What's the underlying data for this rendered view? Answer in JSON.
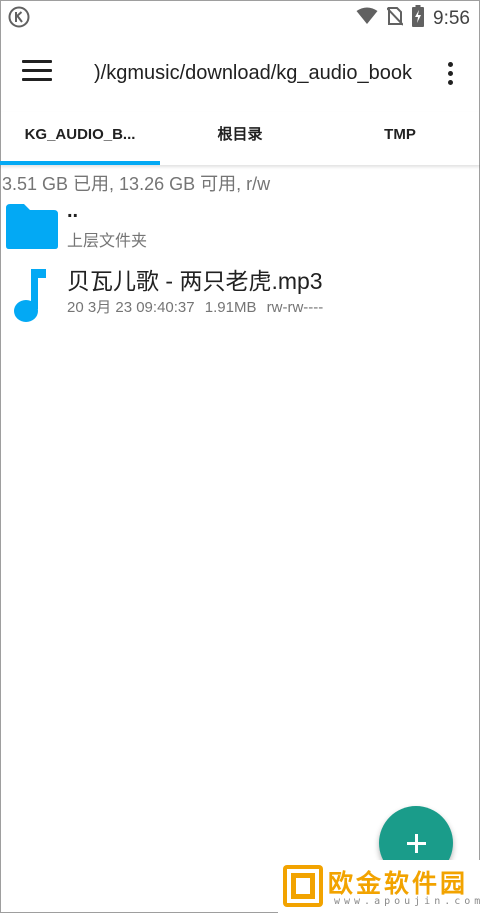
{
  "status_bar": {
    "time": "9:56",
    "icons": [
      "kugou-k-icon",
      "wifi-icon",
      "no-sim-icon",
      "battery-charging-icon"
    ]
  },
  "app_bar": {
    "path": ")/kgmusic/download/kg_audio_book",
    "menu_icon": "hamburger-menu-icon",
    "more_icon": "more-vert-icon"
  },
  "tabs": [
    {
      "label": "KG_AUDIO_B...",
      "selected": true
    },
    {
      "label": "根目录",
      "selected": false
    },
    {
      "label": "TMP",
      "selected": false
    }
  ],
  "colors": {
    "accent": "#03a9f4",
    "fab": "#1a9c8a",
    "folder": "#03a9f4"
  },
  "storage_info": "3.51 GB 已用, 13.26 GB 可用, r/w",
  "parent_row": {
    "name": "..",
    "subtitle": "上层文件夹",
    "icon": "folder-icon"
  },
  "files": [
    {
      "name": "贝瓦儿歌 - 两只老虎.mp3",
      "date": "20 3月 23 09:40:37",
      "size": "1.91MB",
      "perms": "rw-rw----",
      "icon": "music-note-icon"
    }
  ],
  "fab": {
    "icon": "plus-icon"
  },
  "watermark": {
    "text": "欧金软件园",
    "url": "www.apoujin.com"
  }
}
